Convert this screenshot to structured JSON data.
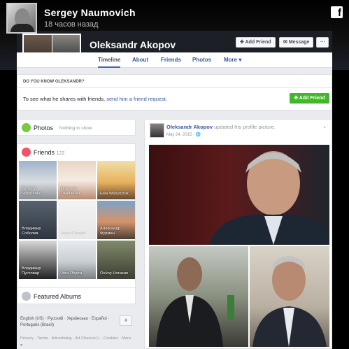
{
  "overlay": {
    "poster_name": "Sergey Naumovich",
    "poster_time": "18 часов назад",
    "logo_glyph": "f"
  },
  "profile": {
    "name": "Oleksandr Akopov",
    "buttons": {
      "add_friend": "Add Friend",
      "message": "Message",
      "more": "···"
    },
    "tabs": [
      "Timeline",
      "About",
      "Friends",
      "Photos",
      "More ▾"
    ]
  },
  "know_box": {
    "title": "DO YOU KNOW OLEKSANDR?",
    "text_prefix": "To see what he shares with friends, ",
    "text_link": "send him a friend request",
    "text_suffix": ".",
    "button": "Add Friend"
  },
  "photos_card": {
    "title": "Photos",
    "subtitle": "Nothing to show",
    "icon": "photos-icon",
    "color": "#7ac943"
  },
  "friends_card": {
    "title": "Friends",
    "count": "122",
    "icon": "friends-icon",
    "color": "#f35369",
    "friends": [
      {
        "name": "Sergii V.\nNazarenko",
        "bg": "linear-gradient(#9fb2c9,#d9dde2 55%,#8b8f94)"
      },
      {
        "name": "Ирышка\nОмеленко",
        "bg": "linear-gradient(#e9d4c4,#f5ece3 50%,#b98b71)"
      },
      {
        "name": "Ewa Wlaszczuk",
        "bg": "linear-gradient(#efe0a9,#e8b25e 55%,#6b4a30)"
      },
      {
        "name": "Владимир\nСоболев",
        "bg": "linear-gradient(#58626e,#2e3540)"
      },
      {
        "name": "Vasyl Cheukh",
        "bg": "linear-gradient(#f3f3f3,#e6e6e6)"
      },
      {
        "name": "Александр\nФурман",
        "bg": "linear-gradient(#7aa3c9,#d6926b 55%,#4a3e36)"
      },
      {
        "name": "Владимир\nПустовар",
        "bg": "linear-gradient(#d8d8d8,#6a6a6a 60%,#222)"
      },
      {
        "name": "Jora Objora",
        "bg": "linear-gradient(#e6ebef,#c9ced3 55%,#7a7f84)"
      },
      {
        "name": "Övünç Horasan",
        "bg": "linear-gradient(#7f8a6a,#3c3f33)"
      }
    ]
  },
  "albums_card": {
    "title": "Featured Albums",
    "icon": "albums-icon",
    "color": "#bec2c9"
  },
  "footer": {
    "languages": "English (US) · Русский · Українська · Español · Português (Brasil)",
    "plus": "+",
    "links": "Privacy · Terms · Advertising · Ad Choices ▷ · Cookies · More ▾"
  },
  "post": {
    "author": "Oleksandr Akopov",
    "action": " updated his profile picture.",
    "date": "May 24, 2015 · 🌐",
    "chevron": "⌄"
  }
}
